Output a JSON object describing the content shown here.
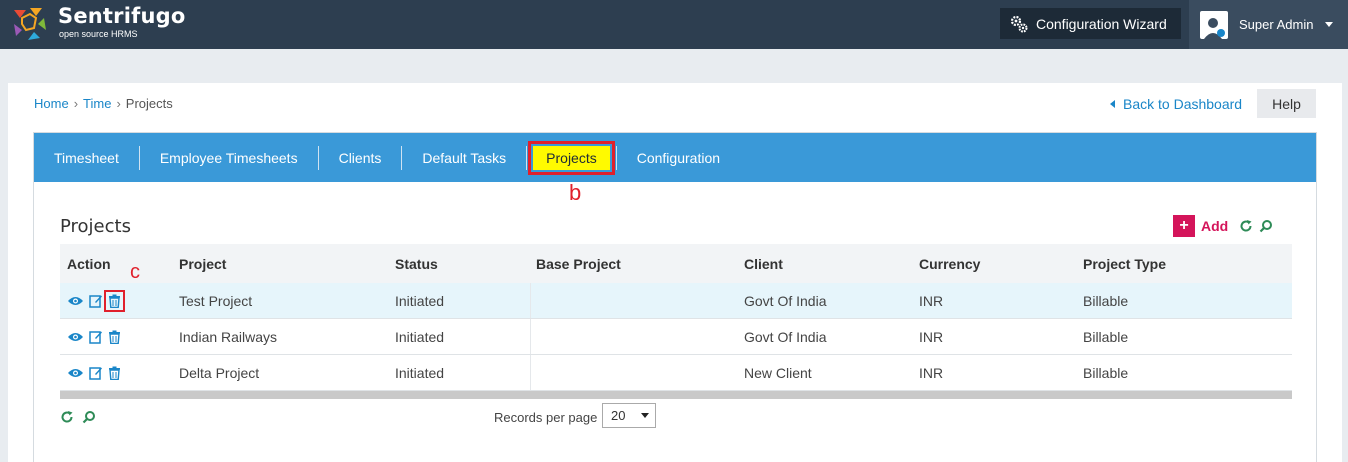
{
  "app": {
    "name": "Sentrifugo",
    "tagline": "open source HRMS"
  },
  "header": {
    "wizard_label": "Configuration Wizard",
    "user_name": "Super Admin"
  },
  "breadcrumb": [
    "Home",
    "Time",
    "Projects"
  ],
  "back_label": "Back to Dashboard",
  "help_label": "Help",
  "tabs": [
    {
      "label": "Timesheet"
    },
    {
      "label": "Employee Timesheets"
    },
    {
      "label": "Clients"
    },
    {
      "label": "Default Tasks"
    },
    {
      "label": "Projects",
      "active": true
    },
    {
      "label": "Configuration"
    }
  ],
  "annotations": {
    "b": "b",
    "c": "c"
  },
  "section": {
    "title": "Projects",
    "add_label": "Add"
  },
  "table": {
    "columns": [
      "Action",
      "Project",
      "Status",
      "Base Project",
      "Client",
      "Currency",
      "Project Type"
    ],
    "rows": [
      {
        "project": "Test Project",
        "status": "Initiated",
        "base": "",
        "client": "Govt Of India",
        "currency": "INR",
        "type": "Billable"
      },
      {
        "project": "Indian Railways",
        "status": "Initiated",
        "base": "",
        "client": "Govt Of India",
        "currency": "INR",
        "type": "Billable"
      },
      {
        "project": "Delta Project",
        "status": "Initiated",
        "base": "",
        "client": "New Client",
        "currency": "INR",
        "type": "Billable"
      }
    ]
  },
  "pagination": {
    "records_label": "Records per page",
    "records_value": "20"
  },
  "colors": {
    "topbar": "#2d3e50",
    "tabbar": "#3a99d8",
    "active_tab": "#fffa00",
    "annotation": "#e0202c",
    "add": "#d4145a",
    "link": "#1a86c8"
  }
}
